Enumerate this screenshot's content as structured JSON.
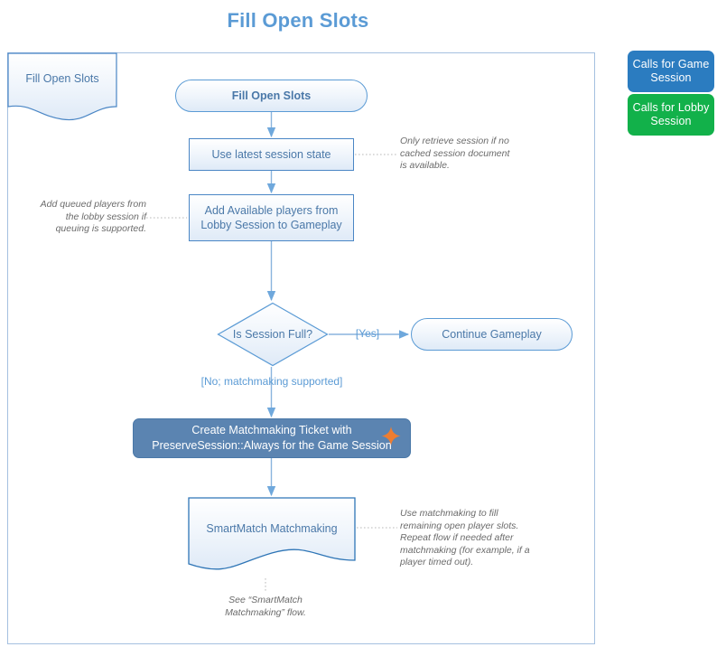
{
  "page": {
    "title": "Fill Open Slots"
  },
  "legend": {
    "items": [
      {
        "label": "Calls for Game Session",
        "color": "#2b7cc0",
        "name": "legend-game-session"
      },
      {
        "label": "Calls for Lobby Session",
        "color": "#12b14a",
        "name": "legend-lobby-session"
      }
    ]
  },
  "diagram": {
    "flow_document_label": "Fill Open Slots",
    "nodes": {
      "start": {
        "label": "Fill Open Slots",
        "shape": "terminator"
      },
      "use_latest_session_state": {
        "label": "Use latest session state",
        "shape": "process"
      },
      "add_available_players": {
        "label": "Add Available players from Lobby Session to Gameplay",
        "shape": "process"
      },
      "is_session_full": {
        "label": "Is Session Full?",
        "shape": "decision"
      },
      "continue_gameplay": {
        "label": "Continue Gameplay",
        "shape": "terminator"
      },
      "create_matchmaking_ticket": {
        "label": "Create Matchmaking Ticket with PreserveSession::Always for the Game Session",
        "shape": "process-filled",
        "badge": "sparkle-icon",
        "badge_color": "#ed7d31"
      },
      "smartmatch_matchmaking": {
        "label": "SmartMatch Matchmaking",
        "shape": "document"
      }
    },
    "branch_labels": {
      "yes": "[Yes]",
      "no": "[No; matchmaking supported]"
    },
    "annotations": {
      "cached_session": "Only retrieve session if no cached session document is available.",
      "queued_players": "Add  queued players from the lobby session if queuing is supported.",
      "use_matchmaking": "Use matchmaking to fill remaining open player slots. Repeat flow if needed after matchmaking (for example, if a player timed out).",
      "see_flow": "See “SmartMatch Matchmaking” flow."
    }
  },
  "colors": {
    "title": "#5b9bd5",
    "frame_border": "#a5c0e0",
    "node_border": "#4a86c5",
    "node_text": "#4a78a8",
    "filled_node": "#5b84b1",
    "annotation_text": "#6b6b6b",
    "accent_star": "#ed7d31"
  }
}
